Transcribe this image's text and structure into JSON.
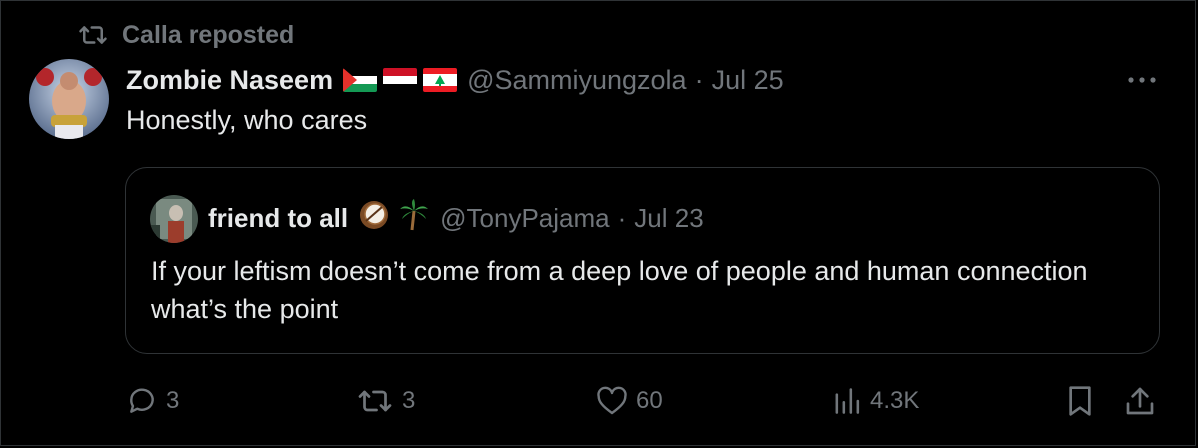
{
  "repost": {
    "icon": "repost-icon",
    "label": "Calla reposted"
  },
  "tweet": {
    "author_name": "Zombie Naseem",
    "flags": [
      "palestine-flag",
      "yemen-flag",
      "lebanon-flag"
    ],
    "handle": "@Sammiyungzola",
    "separator": "·",
    "date": "Jul 25",
    "text": "Honestly, who cares"
  },
  "quote": {
    "author_name": "friend to all",
    "emojis": [
      "coconut-emoji",
      "palm-tree-emoji"
    ],
    "handle": "@TonyPajama",
    "separator": "·",
    "date": "Jul 23",
    "text": "If your leftism doesn’t come from a deep love of people and human connection what’s the point"
  },
  "actions": {
    "replies": "3",
    "reposts": "3",
    "likes": "60",
    "views": "4.3K"
  },
  "colors": {
    "background": "#000000",
    "text": "#e7e9ea",
    "muted": "#71767b",
    "border": "#2f3336"
  }
}
